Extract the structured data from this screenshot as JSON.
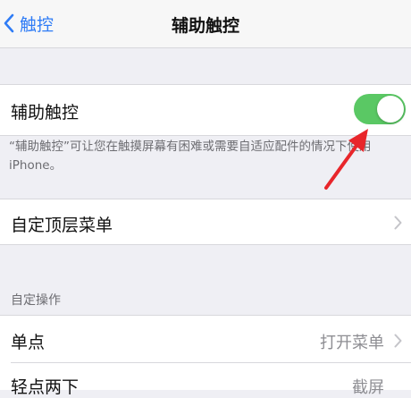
{
  "nav": {
    "back_label": "触控",
    "title": "辅助触控"
  },
  "assistive_touch": {
    "label": "辅助触控",
    "enabled": true,
    "toggle_color": "#5ac864"
  },
  "footnote": "“辅助触控”可让您在触摸屏幕有困难或需要自适应配件的情况下使用iPhone。",
  "menu_row": {
    "label": "自定顶层菜单"
  },
  "custom_actions": {
    "header": "自定操作",
    "rows": [
      {
        "label": "单点",
        "value": "打开菜单"
      },
      {
        "label": "轻点两下",
        "value": "截屏"
      }
    ]
  },
  "colors": {
    "accent": "#2f7cf6",
    "annotation_arrow": "#e8262b"
  }
}
